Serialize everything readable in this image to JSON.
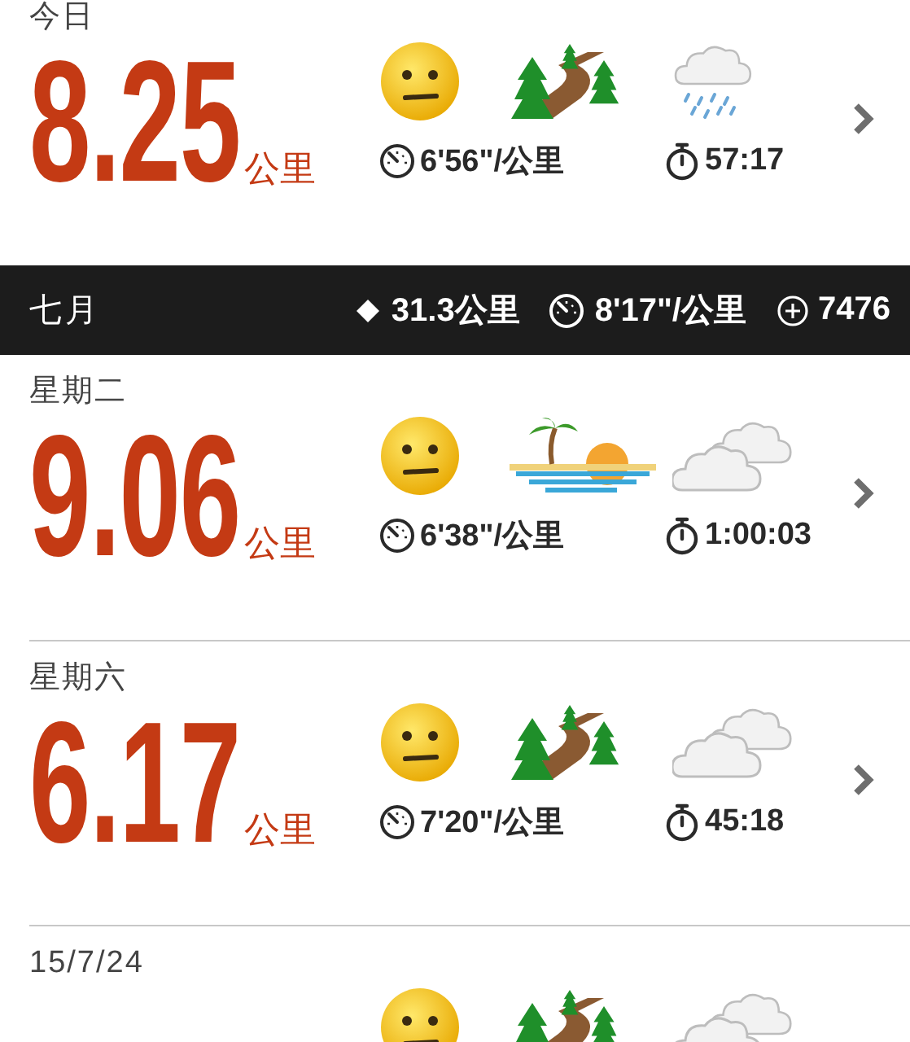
{
  "top_entries": [
    {
      "day": "今日",
      "distance": "8.25",
      "unit": "公里",
      "icons": [
        {
          "kind": "face"
        },
        {
          "kind": "trail"
        },
        {
          "kind": "rain"
        }
      ],
      "pace": "6'56\"/公里",
      "duration": "57:17"
    }
  ],
  "month": {
    "label": "七月",
    "distance": "31.3公里",
    "pace": "8'17\"/公里",
    "steps": "7476"
  },
  "entries": [
    {
      "day": "星期二",
      "distance": "9.06",
      "unit": "公里",
      "icons": [
        {
          "kind": "face"
        },
        {
          "kind": "beach"
        },
        {
          "kind": "cloudy"
        }
      ],
      "pace": "6'38\"/公里",
      "duration": "1:00:03"
    },
    {
      "day": "星期六",
      "distance": "6.17",
      "unit": "公里",
      "icons": [
        {
          "kind": "face"
        },
        {
          "kind": "trail"
        },
        {
          "kind": "cloudy"
        }
      ],
      "pace": "7'20\"/公里",
      "duration": "45:18"
    },
    {
      "day": "15/7/24",
      "icons": [
        {
          "kind": "face"
        },
        {
          "kind": "trail"
        },
        {
          "kind": "cloudy"
        }
      ]
    }
  ]
}
